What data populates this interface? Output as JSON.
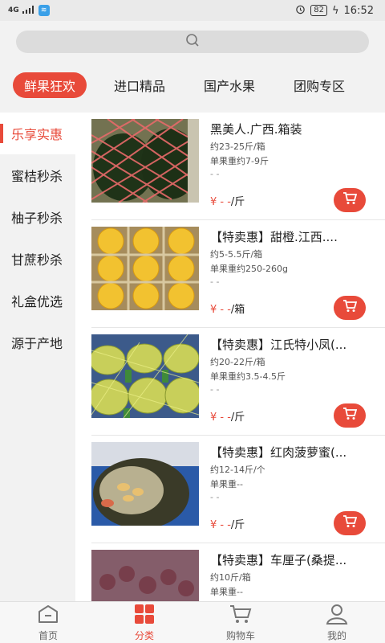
{
  "status_bar": {
    "time": "16:52",
    "battery": "82",
    "network": "4G"
  },
  "search": {
    "icon": "search-icon"
  },
  "top_tabs": [
    {
      "label": "鲜果狂欢",
      "active": true
    },
    {
      "label": "进口精品",
      "active": false
    },
    {
      "label": "国产水果",
      "active": false
    },
    {
      "label": "团购专区",
      "active": false
    }
  ],
  "sidebar": [
    {
      "label": "乐享实惠",
      "active": true
    },
    {
      "label": "蜜桔秒杀"
    },
    {
      "label": "柚子秒杀"
    },
    {
      "label": "甘蔗秒杀"
    },
    {
      "label": "礼盒优选"
    },
    {
      "label": "源于产地"
    }
  ],
  "products": [
    {
      "title": "黑美人.广西.箱装",
      "spec1": "约23-25斤/箱",
      "spec2": "单果重约7-9斤",
      "spec3": "- -",
      "price_symbol": "¥ - -",
      "price_unit": "/斤"
    },
    {
      "title": "【特卖惠】甜橙.江西....",
      "spec1": "约5-5.5斤/箱",
      "spec2": "单果重约250-260g",
      "spec3": "- -",
      "price_symbol": "¥ - -",
      "price_unit": "/箱"
    },
    {
      "title": "【特卖惠】江氏特小凤(...",
      "spec1": "约20-22斤/箱",
      "spec2": "单果重约3.5-4.5斤",
      "spec3": "- -",
      "price_symbol": "¥ - -",
      "price_unit": "/斤"
    },
    {
      "title": "【特卖惠】红肉菠萝蜜(...",
      "spec1": "约12-14斤/个",
      "spec2": "单果重--",
      "spec3": "- -",
      "price_symbol": "¥ - -",
      "price_unit": "/斤"
    },
    {
      "title": "【特卖惠】车厘子(桑提...",
      "spec1": "约10斤/箱",
      "spec2": "单果重--",
      "spec3": "",
      "price_symbol": "",
      "price_unit": ""
    }
  ],
  "tabbar": [
    {
      "label": "首页",
      "icon": "home-icon",
      "active": false
    },
    {
      "label": "分类",
      "icon": "category-icon",
      "active": true
    },
    {
      "label": "购物车",
      "icon": "cart-icon",
      "active": false
    },
    {
      "label": "我的",
      "icon": "profile-icon",
      "active": false
    }
  ],
  "colors": {
    "accent": "#e84a3a",
    "background": "#f2f2f2"
  }
}
